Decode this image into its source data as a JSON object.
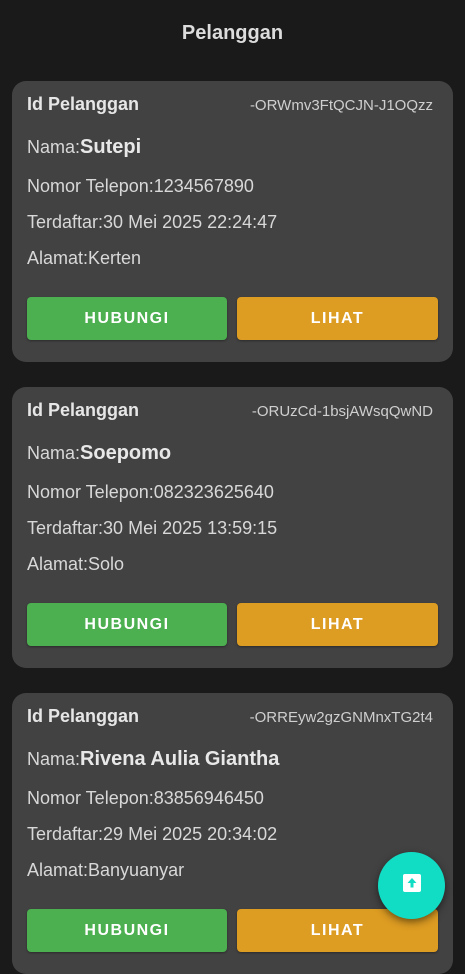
{
  "app_bar": {
    "title": "Pelanggan"
  },
  "customers": [
    {
      "id_label": "Id Pelanggan",
      "id_value": "-ORWmv3FtQCJN-J1OQzz",
      "name_label": "Nama:",
      "name": "Sutepi",
      "phone_label": "Nomor Telepon:",
      "phone": "1234567890",
      "registered_label": "Terdaftar:",
      "registered": "30 Mei 2025 22:24:47",
      "address_label": "Alamat:",
      "address": "Kerten",
      "call_label": "HUBUNGI",
      "view_label": "LIHAT"
    },
    {
      "id_label": "Id Pelanggan",
      "id_value": "-ORUzCd-1bsjAWsqQwND",
      "name_label": "Nama:",
      "name": "Soepomo",
      "phone_label": "Nomor Telepon:",
      "phone": "082323625640",
      "registered_label": "Terdaftar:",
      "registered": "30 Mei 2025 13:59:15",
      "address_label": "Alamat:",
      "address": "Solo",
      "call_label": "HUBUNGI",
      "view_label": "LIHAT"
    },
    {
      "id_label": "Id Pelanggan",
      "id_value": "-ORREyw2gzGNMnxTG2t4",
      "name_label": "Nama:",
      "name": "Rivena Aulia Giantha",
      "phone_label": "Nomor Telepon:",
      "phone": "83856946450",
      "registered_label": "Terdaftar:",
      "registered": "29 Mei 2025 20:34:02",
      "address_label": "Alamat:",
      "address": "Banyuanyar",
      "call_label": "HUBUNGI",
      "view_label": "LIHAT"
    }
  ],
  "fab": {
    "icon": "upload-icon"
  },
  "colors": {
    "background": "#1a1a1a",
    "card": "#424242",
    "call_button": "#4caf50",
    "view_button": "#dd9c22",
    "fab": "#11dcc4"
  }
}
